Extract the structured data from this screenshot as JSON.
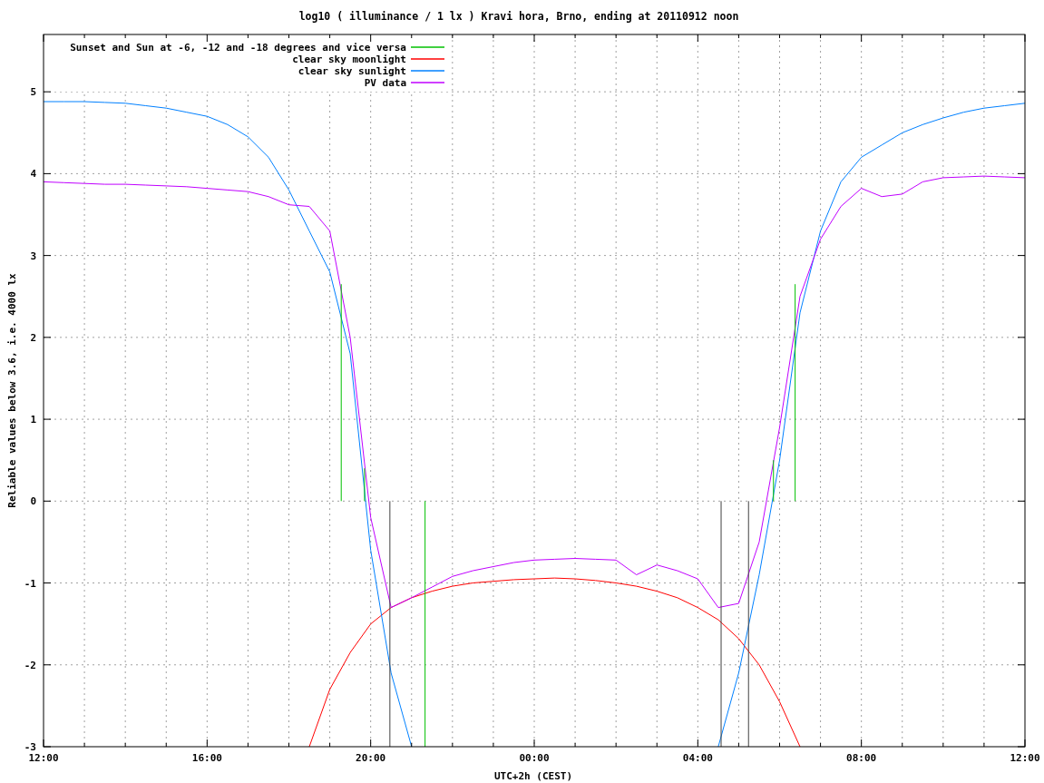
{
  "chart_data": {
    "type": "line",
    "title": "log10 ( illuminance / 1 lx ) Kravi hora, Brno, ending at 20110912 noon",
    "xlabel": "UTC+2h (CEST)",
    "ylabel": "Reliable values below 3.6, i.e. 4000 lx",
    "categories": [
      "12:00",
      null,
      null,
      null,
      null,
      null,
      null,
      null,
      "16:00",
      null,
      null,
      null,
      null,
      null,
      null,
      null,
      "20:00",
      null,
      null,
      null,
      null,
      null,
      null,
      null,
      "00:00",
      null,
      null,
      null,
      null,
      null,
      null,
      null,
      "04:00",
      null,
      null,
      null,
      null,
      null,
      null,
      null,
      "08:00",
      null,
      null,
      null,
      null,
      null,
      null,
      null,
      "12:00"
    ],
    "series": [
      {
        "name": "Sunset and Sun at -6, -12 and -18 degrees and vice versa",
        "color": "#00c000",
        "values": [
          null,
          null,
          null,
          null,
          null,
          null,
          null,
          null,
          null,
          null,
          null,
          null,
          null,
          null,
          null,
          null,
          null,
          null,
          null,
          null,
          null,
          null,
          null,
          null,
          null,
          null,
          null,
          null,
          null,
          null,
          null,
          null,
          null,
          null,
          null,
          null,
          null,
          null,
          null,
          null,
          null,
          null,
          null,
          null,
          null,
          null,
          null,
          null,
          null
        ]
      },
      {
        "name": "clear sky moonlight",
        "color": "#ff0000",
        "values": [
          null,
          null,
          null,
          null,
          null,
          null,
          null,
          null,
          null,
          null,
          null,
          null,
          null,
          -3,
          -2.3,
          -1.85,
          -1.5,
          -1.3,
          -1.18,
          -1.1,
          -1.04,
          -1.0,
          -0.98,
          -0.96,
          -0.95,
          -0.94,
          -0.95,
          -0.97,
          -1.0,
          -1.04,
          -1.1,
          -1.18,
          -1.3,
          -1.45,
          -1.68,
          -2.0,
          -2.45,
          -3,
          null,
          null,
          null,
          null,
          null,
          null,
          null,
          null,
          null,
          null,
          null
        ]
      },
      {
        "name": "clear sky sunlight",
        "color": "#0080ff",
        "values": [
          4.88,
          4.88,
          4.88,
          4.87,
          4.86,
          4.83,
          4.8,
          4.75,
          4.7,
          4.6,
          4.45,
          4.2,
          3.8,
          3.3,
          2.8,
          1.8,
          -0.6,
          -2.1,
          -3,
          null,
          null,
          null,
          null,
          null,
          null,
          null,
          null,
          null,
          null,
          null,
          null,
          null,
          null,
          -3,
          -2.1,
          -0.9,
          0.5,
          2.3,
          3.3,
          3.9,
          4.2,
          4.35,
          4.5,
          4.6,
          4.68,
          4.75,
          4.8,
          4.83,
          4.86
        ]
      },
      {
        "name": "PV data",
        "color": "#c000ff",
        "values": [
          3.9,
          3.89,
          3.88,
          3.87,
          3.87,
          3.86,
          3.85,
          3.84,
          3.82,
          3.8,
          3.78,
          3.72,
          3.62,
          3.6,
          3.3,
          2.0,
          -0.2,
          -1.3,
          -1.18,
          -1.05,
          -0.92,
          -0.85,
          -0.8,
          -0.75,
          -0.72,
          -0.71,
          -0.7,
          -0.71,
          -0.72,
          -0.9,
          -0.78,
          -0.85,
          -0.95,
          -1.3,
          -1.25,
          -0.5,
          0.9,
          2.5,
          3.2,
          3.6,
          3.82,
          3.72,
          3.75,
          3.9,
          3.95,
          3.96,
          3.97,
          3.96,
          3.95
        ]
      }
    ],
    "ylim": [
      -3,
      5.7
    ],
    "yticks": [
      -3,
      -2,
      -1,
      0,
      1,
      2,
      3,
      4,
      5
    ],
    "grid": true,
    "legend": true
  }
}
